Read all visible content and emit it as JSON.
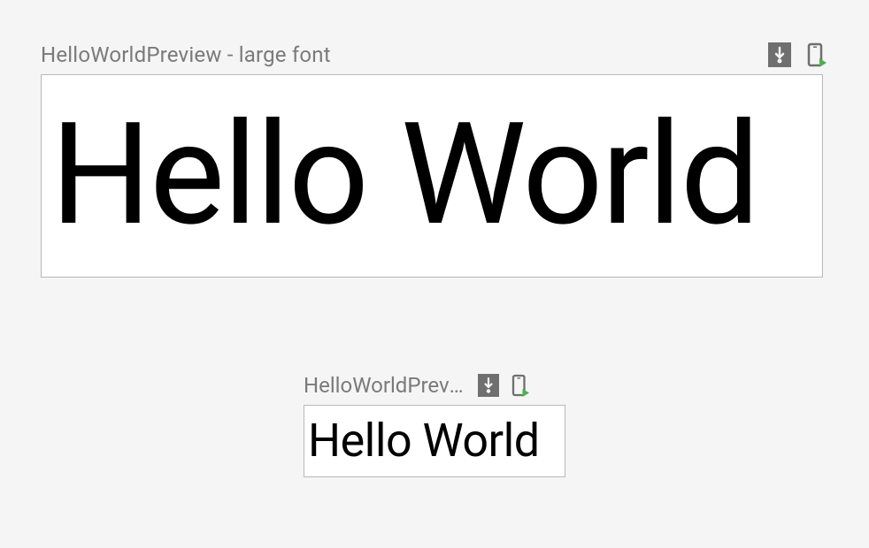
{
  "previews": [
    {
      "title": "HelloWorldPreview - large font",
      "content": "Hello World"
    },
    {
      "title": "HelloWorldPreview",
      "content": "Hello World"
    }
  ]
}
